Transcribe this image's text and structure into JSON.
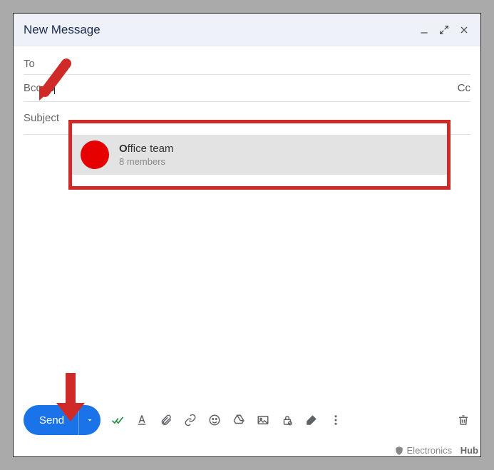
{
  "window": {
    "title": "New Message"
  },
  "fields": {
    "to_label": "To",
    "bcc_label": "Bcc",
    "bcc_value": "o",
    "cc_label": "Cc",
    "subject_label": "Subject"
  },
  "suggestion": {
    "name_bold": "O",
    "name_rest": "ffice team",
    "subtitle": "8 members"
  },
  "toolbar": {
    "send_label": "Send"
  },
  "watermark": {
    "text1": "Electronics",
    "text2": "Hub"
  }
}
